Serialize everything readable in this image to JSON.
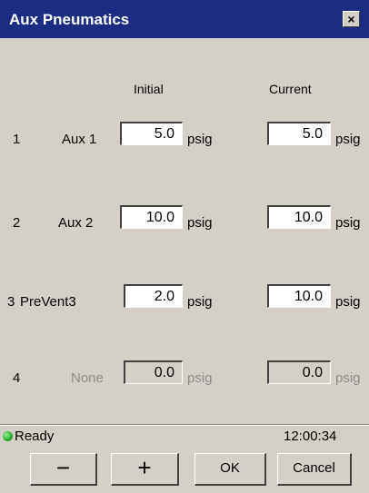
{
  "window": {
    "title": "Aux Pneumatics",
    "close_label": "×"
  },
  "columns": {
    "initial": "Initial",
    "current": "Current"
  },
  "unit": "psig",
  "rows": [
    {
      "num": "1",
      "name": "Aux 1",
      "initial": "5.0",
      "current": "5.0",
      "enabled": true
    },
    {
      "num": "2",
      "name": "Aux 2",
      "initial": "10.0",
      "current": "10.0",
      "enabled": true
    },
    {
      "num": "3",
      "name": "PreVent3",
      "initial": "2.0",
      "current": "10.0",
      "enabled": true
    },
    {
      "num": "4",
      "name": "None",
      "initial": "0.0",
      "current": "0.0",
      "enabled": false
    }
  ],
  "status": {
    "text": "Ready",
    "time": "12:00:34",
    "indicator_color": "#2fae35"
  },
  "buttons": {
    "minus": "−",
    "plus": "+",
    "ok": "OK",
    "cancel": "Cancel"
  },
  "colors": {
    "titlebar": "#1c2c82",
    "window_bg": "#d4d0c8",
    "disabled_text": "#8c8c8c"
  }
}
